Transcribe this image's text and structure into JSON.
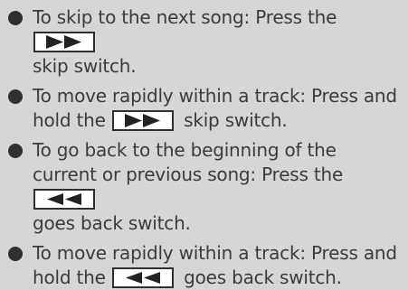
{
  "items": [
    {
      "line1_before": "To skip to the next song: Press the",
      "line2": "skip switch."
    },
    {
      "line1": "To move rapidly within a track: Press and",
      "line2_before": "hold the",
      "line2_after": "skip switch."
    },
    {
      "line1": "To go back to the beginning of the",
      "line2_before": "current or previous song: Press the",
      "line3": "goes back switch."
    },
    {
      "line1": "To move rapidly within a track: Press and",
      "line2_before": "hold the",
      "line2_after": "goes back switch."
    }
  ],
  "icons": {
    "forward": "fast-forward-icon",
    "back": "rewind-icon"
  }
}
